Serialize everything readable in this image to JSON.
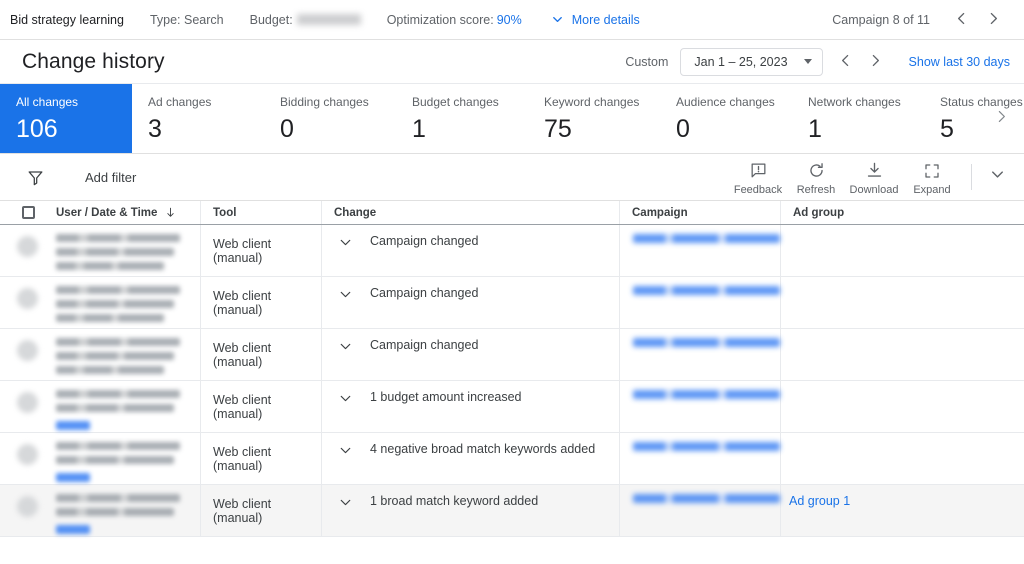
{
  "topbar": {
    "campaign_status": "Bid strategy learning",
    "type": "Type: Search",
    "budget_label": "Budget:",
    "optimization_label": "Optimization score:",
    "optimization_value": "90%",
    "more_details": "More details",
    "campaign_counter": "Campaign 8 of 11",
    "prev_icon": "chevron-left-icon",
    "next_icon": "chevron-right-icon"
  },
  "header": {
    "title": "Change history",
    "date_label": "Custom",
    "date_value": "Jan 1 – 25, 2023",
    "show_last": "Show last 30 days"
  },
  "metrics": [
    {
      "label": "All changes",
      "value": "106",
      "active": true
    },
    {
      "label": "Ad changes",
      "value": "3",
      "active": false
    },
    {
      "label": "Bidding changes",
      "value": "0",
      "active": false
    },
    {
      "label": "Budget changes",
      "value": "1",
      "active": false
    },
    {
      "label": "Keyword changes",
      "value": "75",
      "active": false
    },
    {
      "label": "Audience changes",
      "value": "0",
      "active": false
    },
    {
      "label": "Network changes",
      "value": "1",
      "active": false
    },
    {
      "label": "Status changes",
      "value": "5",
      "active": false
    }
  ],
  "toolbar": {
    "filter_icon": "filter-funnel-icon",
    "add_filter": "Add filter",
    "tools": [
      {
        "label": "Feedback",
        "icon": "feedback-icon"
      },
      {
        "label": "Refresh",
        "icon": "refresh-icon"
      },
      {
        "label": "Download",
        "icon": "download-icon"
      },
      {
        "label": "Expand",
        "icon": "expand-icon"
      }
    ]
  },
  "table": {
    "columns": {
      "user": "User / Date & Time",
      "tool": "Tool",
      "change": "Change",
      "campaign": "Campaign",
      "adgroup": "Ad group"
    },
    "sort_icon": "sort-descending-arrow-icon",
    "rows": [
      {
        "tool": "Web client (manual)",
        "change": "Campaign changed",
        "adgroup": "",
        "user_redacted": true,
        "user_has_link": false,
        "campaign_redacted": true,
        "hover": false
      },
      {
        "tool": "Web client (manual)",
        "change": "Campaign changed",
        "adgroup": "",
        "user_redacted": true,
        "user_has_link": false,
        "campaign_redacted": true,
        "hover": false
      },
      {
        "tool": "Web client (manual)",
        "change": "Campaign changed",
        "adgroup": "",
        "user_redacted": true,
        "user_has_link": false,
        "campaign_redacted": true,
        "hover": false
      },
      {
        "tool": "Web client (manual)",
        "change": "1 budget amount increased",
        "adgroup": "",
        "user_redacted": true,
        "user_has_link": true,
        "campaign_redacted": true,
        "hover": false
      },
      {
        "tool": "Web client (manual)",
        "change": "4 negative broad match keywords added",
        "adgroup": "",
        "user_redacted": true,
        "user_has_link": true,
        "campaign_redacted": true,
        "hover": false
      },
      {
        "tool": "Web client (manual)",
        "change": "1 broad match keyword added",
        "adgroup": "Ad group 1",
        "user_redacted": true,
        "user_has_link": true,
        "campaign_redacted": true,
        "hover": true
      }
    ]
  },
  "colors": {
    "accent": "#1a73e8",
    "link": "#1a73e8",
    "text": "#3c4043",
    "muted": "#5f6368",
    "border": "#e8eaed"
  }
}
